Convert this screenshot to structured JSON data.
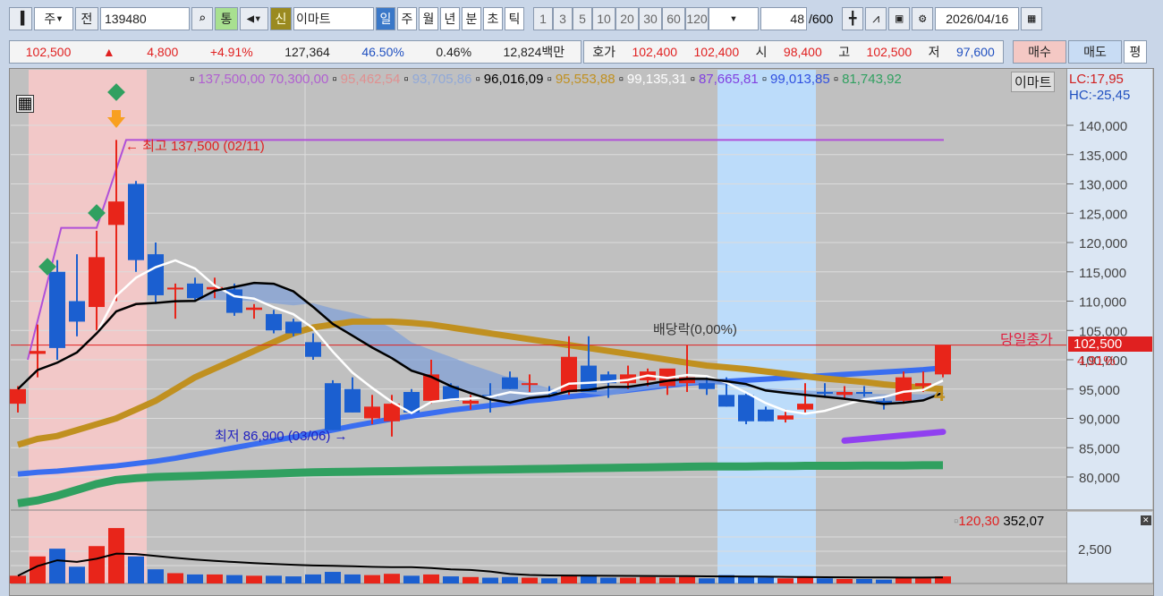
{
  "toolbar": {
    "market": "주",
    "prev_label": "전",
    "code": "139480",
    "tong": "통",
    "shin": "신",
    "name": "이마트",
    "periods": [
      "일",
      "주",
      "월",
      "년",
      "분",
      "초",
      "틱"
    ],
    "intervals": [
      "1",
      "3",
      "5",
      "10",
      "20",
      "30",
      "60",
      "120"
    ],
    "count": "48",
    "count_total": "/600",
    "date": "2026/04/16"
  },
  "quote": {
    "price": "102,500",
    "arrow": "▲",
    "change": "4,800",
    "pct": "+4.91%",
    "volume": "127,364",
    "vol_ratio": "46.50%",
    "turnover": "0.46%",
    "amount": "12,824백만",
    "hoga_label": "호가",
    "bid": "102,400",
    "ask": "102,400",
    "open_label": "시",
    "open": "98,400",
    "high_label": "고",
    "high": "102,500",
    "low_label": "저",
    "low": "97,600",
    "buy": "매수",
    "sell": "매도",
    "eval": "평"
  },
  "legend": {
    "items": [
      {
        "text": "137,500,00 70,300,00",
        "color": "#b060d0"
      },
      {
        "text": "95,462,54",
        "color": "#e09090"
      },
      {
        "text": "93,705,86",
        "color": "#90a8d8"
      },
      {
        "text": "96,016,09",
        "color": "#000000"
      },
      {
        "text": "95,553,88",
        "color": "#c09020"
      },
      {
        "text": "99,135,31",
        "color": "#ffffff"
      },
      {
        "text": "87,665,81",
        "color": "#8040e0"
      },
      {
        "text": "99,013,85",
        "color": "#3050e0"
      },
      {
        "text": "81,743,92",
        "color": "#30a060"
      }
    ],
    "name": "이마트",
    "lc": "LC:17,95",
    "hc": "HC:-25,45"
  },
  "annotations": {
    "high": "최고 137,500 (02/11)",
    "low": "최저 86,900 (03/06)",
    "dividend": "배당락(0,00%)",
    "close_label": "당일종가",
    "last_price": "102,500",
    "last_pct": "4,91%",
    "marker": "4"
  },
  "volume_pane": {
    "legend1": "120,30",
    "legend2": "352,07",
    "tick": "2,500"
  },
  "colors": {
    "up": "#e8251a",
    "down": "#1b5fd0"
  },
  "chart_data": {
    "type": "candlestick",
    "yticks": [
      140000,
      135000,
      130000,
      125000,
      120000,
      115000,
      110000,
      105000,
      100000,
      95000,
      90000,
      85000,
      80000
    ],
    "ytick_labels": [
      "140,000",
      "135,000",
      "130,000",
      "125,000",
      "120,000",
      "115,000",
      "110,000",
      "105,000",
      "100,000",
      "95,000",
      "90,000",
      "85,000",
      "80,000"
    ],
    "ohlc": [
      [
        92500,
        95500,
        91000,
        95000
      ],
      [
        101000,
        106000,
        97000,
        101500
      ],
      [
        115000,
        117000,
        100000,
        102000
      ],
      [
        110000,
        118000,
        104000,
        106500
      ],
      [
        109000,
        122000,
        105000,
        117500
      ],
      [
        123000,
        137500,
        110000,
        127000
      ],
      [
        130000,
        130500,
        115000,
        117000
      ],
      [
        118000,
        120000,
        109500,
        111000
      ],
      [
        112000,
        113000,
        107000,
        112300
      ],
      [
        113000,
        114000,
        110000,
        110500
      ],
      [
        112000,
        114000,
        110500,
        112400
      ],
      [
        112000,
        113000,
        107500,
        108000
      ],
      [
        108500,
        109500,
        107000,
        108900
      ],
      [
        107800,
        108500,
        104500,
        105000
      ],
      [
        106500,
        107000,
        104000,
        104500
      ],
      [
        103000,
        104500,
        100000,
        100500
      ],
      [
        96000,
        96500,
        88000,
        88000
      ],
      [
        95000,
        97000,
        91000,
        91000
      ],
      [
        90000,
        94000,
        89000,
        92000
      ],
      [
        89500,
        94000,
        86900,
        92500
      ],
      [
        94500,
        95000,
        91000,
        91000
      ],
      [
        93000,
        100000,
        92500,
        97500
      ],
      [
        95500,
        96000,
        93000,
        93000
      ],
      [
        92500,
        94000,
        91500,
        93000
      ],
      [
        94000,
        96000,
        91000,
        93800
      ],
      [
        97000,
        98000,
        95000,
        95000
      ],
      [
        95800,
        97500,
        94500,
        96000
      ],
      [
        94500,
        95500,
        93500,
        94300
      ],
      [
        94500,
        104000,
        94000,
        100500
      ],
      [
        99000,
        104000,
        94500,
        94500
      ],
      [
        97500,
        98000,
        93500,
        96000
      ],
      [
        96000,
        99000,
        95000,
        97500
      ],
      [
        96500,
        98500,
        95500,
        98000
      ],
      [
        95500,
        98000,
        94000,
        98500
      ],
      [
        96000,
        102500,
        94500,
        97000
      ],
      [
        96000,
        97000,
        94000,
        95000
      ],
      [
        94000,
        97000,
        92000,
        92000
      ],
      [
        94000,
        94500,
        89000,
        89500
      ],
      [
        91500,
        92000,
        89500,
        89500
      ],
      [
        89800,
        91500,
        89300,
        90500
      ],
      [
        91500,
        96000,
        91000,
        92500
      ],
      [
        94500,
        96000,
        93500,
        94400
      ],
      [
        94000,
        95500,
        93500,
        94500
      ],
      [
        94500,
        95500,
        93700,
        94300
      ],
      [
        93000,
        93500,
        91500,
        92500
      ],
      [
        93000,
        98000,
        92500,
        97000
      ],
      [
        95500,
        98000,
        94500,
        96000
      ],
      [
        97500,
        102500,
        97000,
        102500
      ]
    ],
    "gold_ma": [
      85500,
      86500,
      87000,
      88000,
      89000,
      90000,
      91500,
      93000,
      95000,
      97000,
      98500,
      100000,
      101500,
      103000,
      104500,
      105500,
      106000,
      106500,
      106500,
      106500,
      106300,
      106000,
      105500,
      105000,
      104500,
      104000,
      103500,
      103000,
      102500,
      102000,
      101500,
      101000,
      100500,
      100000,
      99500,
      99000,
      98700,
      98400,
      98000,
      97600,
      97200,
      96800,
      96500,
      96200,
      95800,
      95500,
      95200,
      95000
    ],
    "blue_line": [
      80500,
      80800,
      81000,
      81300,
      81600,
      81900,
      82300,
      82700,
      83200,
      83800,
      84400,
      85000,
      85600,
      86200,
      86800,
      87400,
      88000,
      88700,
      89300,
      89900,
      90400,
      90900,
      91400,
      91800,
      92200,
      92600,
      93000,
      93300,
      93700,
      94000,
      94400,
      94800,
      95200,
      95600,
      96000,
      96200,
      96300,
      96500,
      96700,
      96900,
      97100,
      97300,
      97500,
      97700,
      97900,
      98100,
      98300,
      98600
    ],
    "green_line": [
      75500,
      76000,
      76800,
      77800,
      78800,
      79500,
      79800,
      80000,
      80100,
      80200,
      80300,
      80400,
      80500,
      80600,
      80700,
      80800,
      80850,
      80900,
      80950,
      81000,
      81050,
      81100,
      81150,
      81200,
      81250,
      81300,
      81350,
      81400,
      81450,
      81500,
      81550,
      81600,
      81650,
      81700,
      81750,
      81800,
      81800,
      81800,
      81850,
      81850,
      81900,
      81900,
      81900,
      81950,
      81950,
      81950,
      82000,
      82000
    ],
    "volume": [
      600,
      2100,
      2700,
      1300,
      2900,
      4300,
      2100,
      1100,
      800,
      700,
      700,
      650,
      600,
      600,
      550,
      700,
      900,
      700,
      650,
      750,
      600,
      700,
      550,
      500,
      450,
      500,
      450,
      400,
      650,
      600,
      450,
      450,
      500,
      450,
      500,
      400,
      650,
      550,
      450,
      400,
      500,
      400,
      350,
      350,
      300,
      450,
      400,
      550
    ],
    "period_high": 137500,
    "period_low": 86900,
    "last_close": 102500
  }
}
